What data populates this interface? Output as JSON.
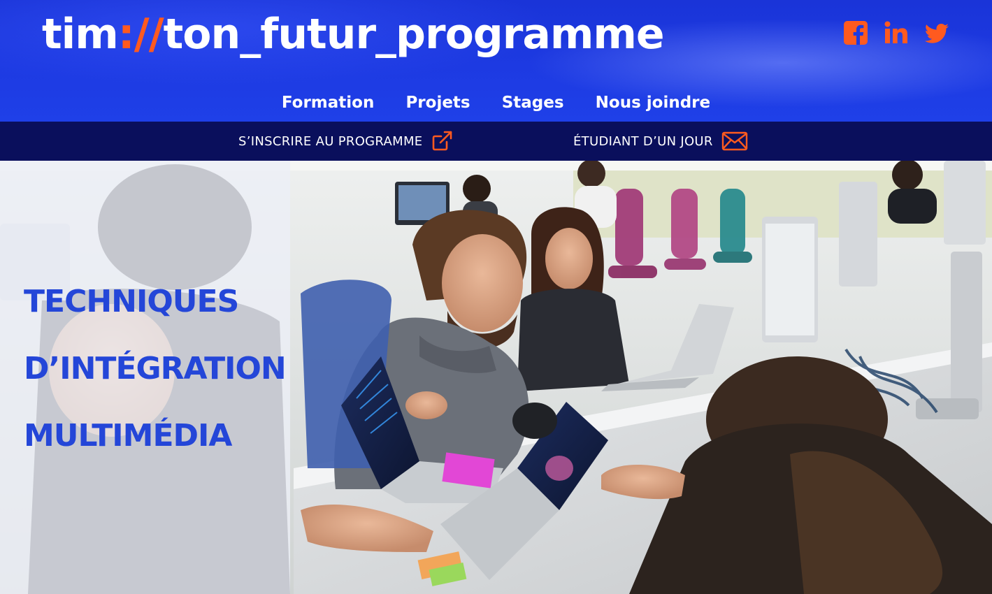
{
  "header": {
    "logo": {
      "prefix": "tim",
      "separator": "://",
      "suffix": "ton_futur_programme"
    },
    "socials": [
      {
        "icon": "facebook-icon"
      },
      {
        "icon": "linkedin-icon"
      },
      {
        "icon": "twitter-icon"
      }
    ],
    "nav": [
      {
        "label": "Formation"
      },
      {
        "label": "Projets"
      },
      {
        "label": "Stages"
      },
      {
        "label": "Nous joindre"
      }
    ]
  },
  "action_bar": {
    "register": {
      "label": "S’INSCRIRE AU PROGRAMME",
      "icon": "external-link-icon"
    },
    "student_day": {
      "label": "ÉTUDIANT D’UN JOUR",
      "icon": "envelope-icon"
    }
  },
  "hero": {
    "title_lines": [
      "TECHNIQUES",
      "D’INTÉGRATION",
      "MULTIMÉDIA"
    ],
    "image_alt": "students-working-at-computers-photo"
  },
  "colors": {
    "header_blue": "#1d3ae2",
    "action_bar_navy": "#0a0f5c",
    "accent_orange": "#ff5a1f",
    "title_blue": "#2446d8"
  }
}
